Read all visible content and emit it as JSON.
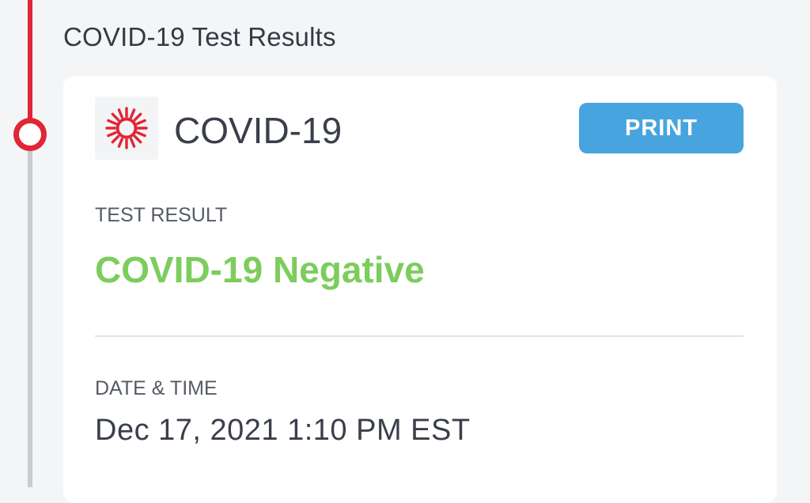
{
  "section_title": "COVID-19 Test Results",
  "card": {
    "title": "COVID-19",
    "logo_icon": "sun-burst-icon",
    "print_label": "PRINT",
    "result_label": "TEST RESULT",
    "result_value": "COVID-19 Negative",
    "datetime_label": "DATE & TIME",
    "datetime_value": "Dec 17, 2021 1:10 PM EST"
  },
  "colors": {
    "timeline_active": "#e12535",
    "timeline_inactive": "#c8cbd0",
    "print_button": "#48a4df",
    "result_negative": "#7ccd5c",
    "logo": "#e12535"
  }
}
